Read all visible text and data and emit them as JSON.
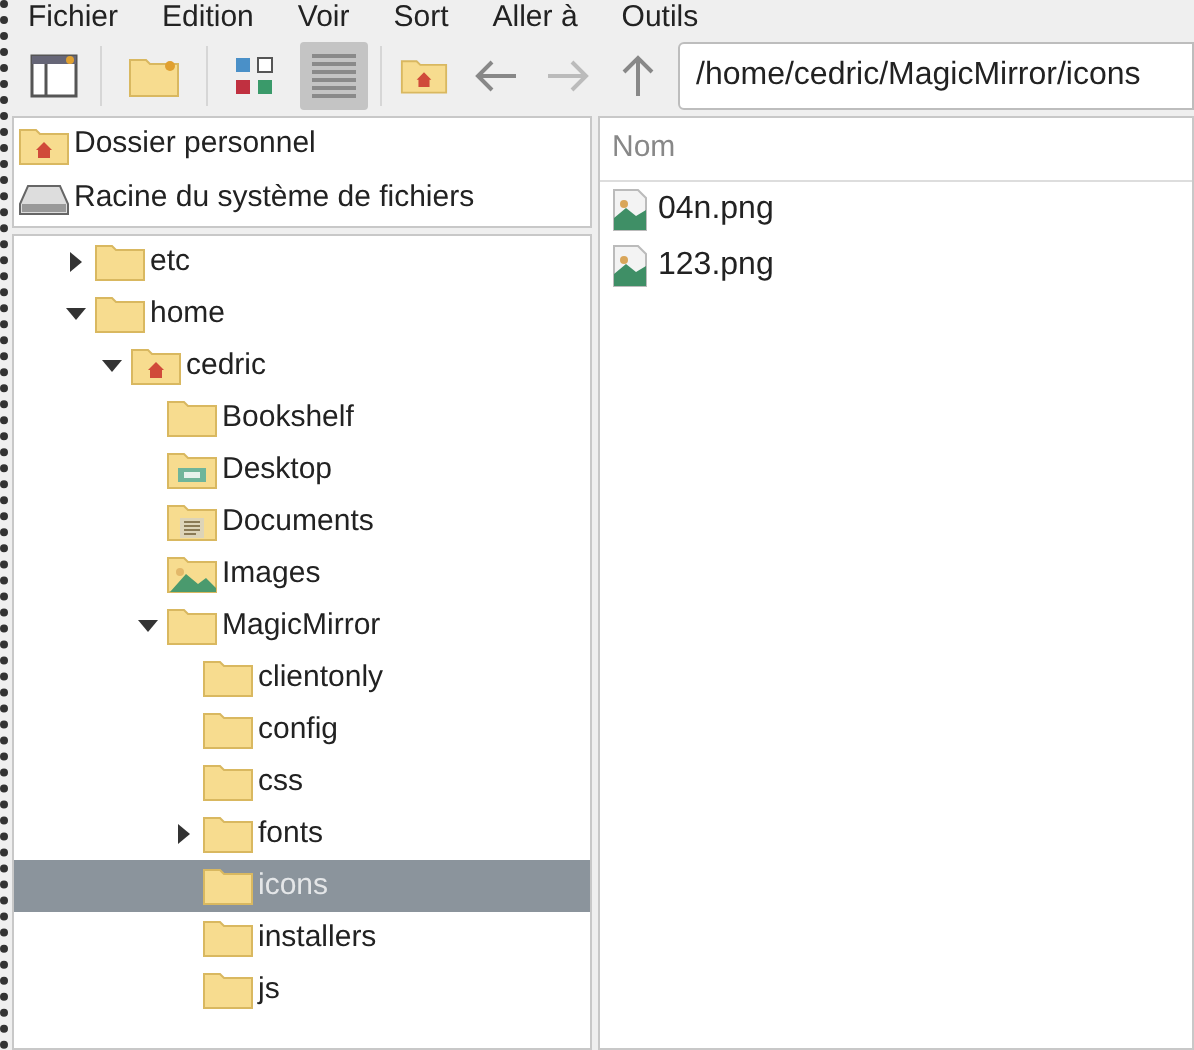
{
  "menu": [
    "Fichier",
    "Edition",
    "Voir",
    "Sort",
    "Aller à",
    "Outils"
  ],
  "toolbar": {
    "view_buttons": [
      {
        "kind": "icons",
        "selected": false
      },
      {
        "kind": "list",
        "selected": true
      }
    ],
    "path": "/home/cedric/MagicMirror/icons"
  },
  "places": [
    {
      "kind": "home",
      "label": "Dossier personnel"
    },
    {
      "kind": "drive",
      "label": "Racine du système de fichiers"
    }
  ],
  "tree": [
    {
      "label": "etc",
      "kind": "folder",
      "expanded": false,
      "selected": false
    },
    {
      "label": "home",
      "kind": "folder",
      "expanded": true,
      "selected": false,
      "children": [
        {
          "label": "cedric",
          "kind": "home",
          "expanded": true,
          "selected": false,
          "children": [
            {
              "label": "Bookshelf",
              "kind": "folder",
              "selected": false
            },
            {
              "label": "Desktop",
              "kind": "desktop",
              "selected": false
            },
            {
              "label": "Documents",
              "kind": "documents",
              "selected": false
            },
            {
              "label": "Images",
              "kind": "images",
              "selected": false
            },
            {
              "label": "MagicMirror",
              "kind": "folder",
              "expanded": true,
              "selected": false,
              "children": [
                {
                  "label": "clientonly",
                  "kind": "folder",
                  "selected": false
                },
                {
                  "label": "config",
                  "kind": "folder",
                  "selected": false
                },
                {
                  "label": "css",
                  "kind": "folder",
                  "selected": false
                },
                {
                  "label": "fonts",
                  "kind": "folder",
                  "expanded": false,
                  "selected": false
                },
                {
                  "label": "icons",
                  "kind": "folder",
                  "selected": true
                },
                {
                  "label": "installers",
                  "kind": "folder",
                  "selected": false
                },
                {
                  "label": "js",
                  "kind": "folder",
                  "selected": false
                }
              ]
            }
          ]
        }
      ]
    }
  ],
  "files": {
    "column": "Nom",
    "items": [
      "04n.png",
      "123.png"
    ]
  }
}
